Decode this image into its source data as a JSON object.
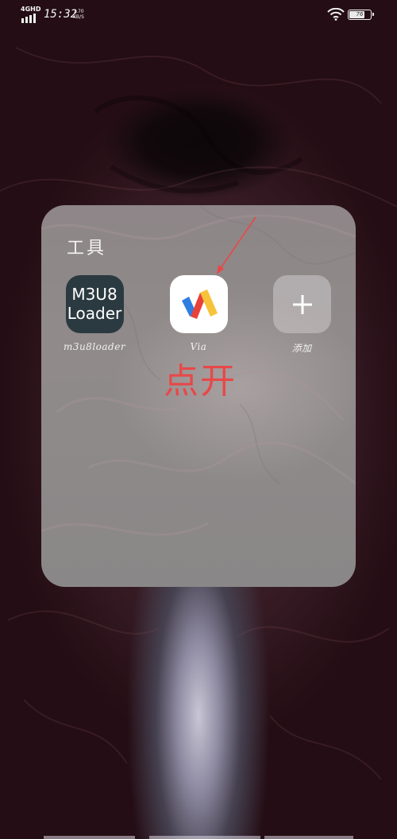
{
  "status_bar": {
    "network": "4GHD",
    "time": "15:32",
    "speed_value": "1.70",
    "speed_unit": "KB/S",
    "battery_level": "76",
    "battery_percent": 76
  },
  "folder": {
    "title": "工具",
    "apps": [
      {
        "name": "m3u8loader",
        "icon_text_line1": "M3U8",
        "icon_text_line2": "Loader",
        "icon": "m3u8-loader-icon"
      },
      {
        "name": "Via",
        "icon": "via-browser-icon"
      },
      {
        "name": "添加",
        "icon": "plus-icon"
      }
    ]
  },
  "annotation": {
    "text": "点开",
    "color": "#e84848"
  },
  "colors": {
    "m3u8_icon_bg": "#2b3a40",
    "via_red": "#e8413a",
    "via_yellow": "#f6c33b",
    "via_blue": "#2f7de1"
  }
}
